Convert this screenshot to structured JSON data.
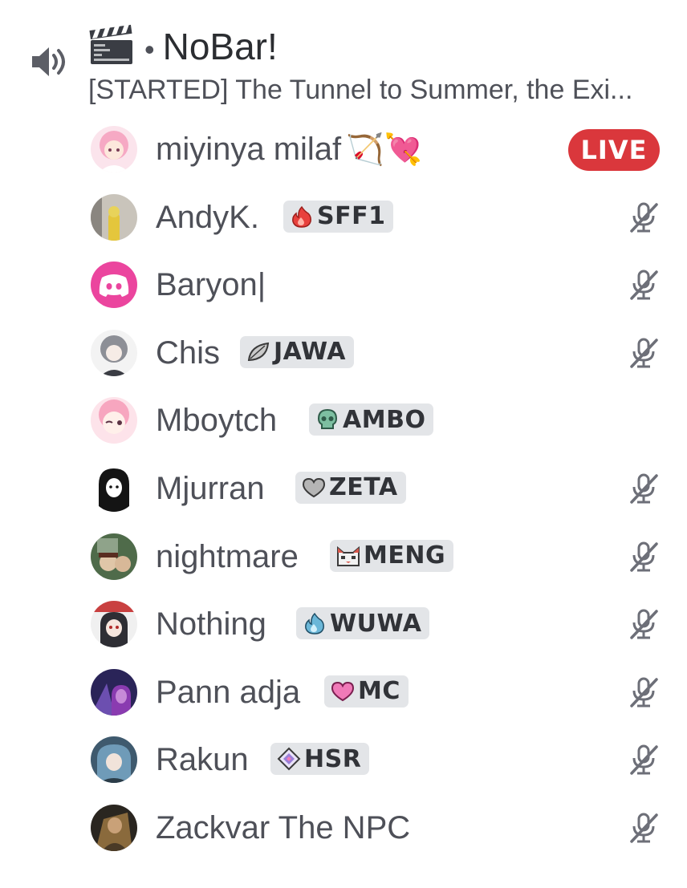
{
  "channel": {
    "emoji": "🎬",
    "separator": "•",
    "name": "NoBar!",
    "status": "[STARTED] The Tunnel to Summer, the Exi..."
  },
  "users": [
    {
      "name": "miyinya milaf",
      "emoji": "🏹💘",
      "live_label": "LIVE"
    },
    {
      "name": "AndyK.",
      "tag": "SFF1",
      "tag_icon": "flame-icon",
      "tag_color": "#e8413d",
      "muted": true
    },
    {
      "name": "Baryon|",
      "muted": true
    },
    {
      "name": "Chis",
      "tag": "JAWA",
      "tag_icon": "leaf-icon",
      "tag_color": "#b8b8b8",
      "muted": true
    },
    {
      "name": "Mboytch",
      "tag": "AMBO",
      "tag_icon": "skull-icon",
      "tag_color": "#5fa58a",
      "muted": false
    },
    {
      "name": "Mjurran",
      "tag": "ZETA",
      "tag_icon": "heart-icon",
      "tag_color": "#a9a9a9",
      "muted": true
    },
    {
      "name": "nightmare",
      "tag": "MENG",
      "tag_icon": "cat-icon",
      "tag_color": "#d9584c",
      "muted": true
    },
    {
      "name": "Nothing",
      "tag": "WUWA",
      "tag_icon": "flame-icon",
      "tag_color": "#6bb7d8",
      "muted": true
    },
    {
      "name": "Pann adja",
      "tag": "MC",
      "tag_icon": "heart-icon",
      "tag_color": "#f07ab8",
      "muted": true
    },
    {
      "name": "Rakun",
      "tag": "HSR",
      "tag_icon": "diamond-icon",
      "tag_color": "#9b7fd9",
      "muted": true
    },
    {
      "name": "Zackvar The NPC",
      "muted": true
    }
  ],
  "colors": {
    "live": "#da373c",
    "discord_blurple_pink": "#eb459e",
    "text": "#4e5058",
    "tag_bg": "#e3e5e8"
  }
}
